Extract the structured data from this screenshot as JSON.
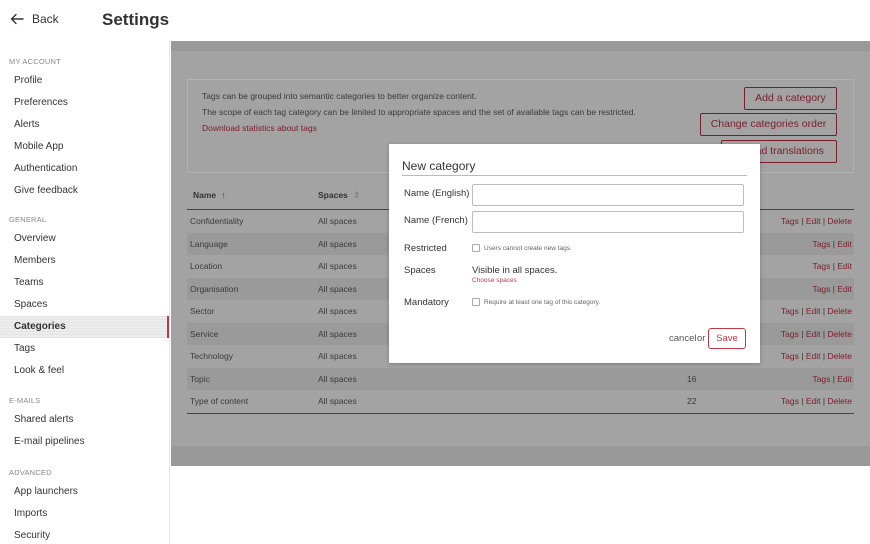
{
  "header": {
    "back_label": "Back",
    "title": "Settings"
  },
  "sidebar": {
    "sections": [
      {
        "title": "MY ACCOUNT",
        "items": [
          "Profile",
          "Preferences",
          "Alerts",
          "Mobile App",
          "Authentication",
          "Give feedback"
        ]
      },
      {
        "title": "GENERAL",
        "items": [
          "Overview",
          "Members",
          "Teams",
          "Spaces",
          "Categories",
          "Tags",
          "Look & feel"
        ]
      },
      {
        "title": "E-MAILS",
        "items": [
          "Shared alerts",
          "E-mail pipelines"
        ]
      },
      {
        "title": "ADVANCED",
        "items": [
          "App launchers",
          "Imports",
          "Security"
        ]
      }
    ],
    "active": "Categories"
  },
  "info": {
    "line1": "Tags can be grouped into semantic categories to better organize content.",
    "line2": "The scope of each tag category can be limited to appropriate spaces and the set of available tags can be restricted.",
    "download_link": "Download statistics about tags",
    "add_button": "Add a category",
    "order_button": "Change categories order",
    "upload_button": "Upload translations"
  },
  "table": {
    "columns": {
      "name": "Name",
      "name_sort": "↑",
      "spaces": "Spaces",
      "spaces_sort": "⇕"
    },
    "rows": [
      {
        "name": "Confidentiality",
        "spaces": "All spaces",
        "count": "",
        "actions": [
          "Tags",
          "Edit",
          "Delete"
        ]
      },
      {
        "name": "Language",
        "spaces": "All spaces",
        "count": "",
        "actions": [
          "Tags",
          "Edit"
        ]
      },
      {
        "name": "Location",
        "spaces": "All spaces",
        "count": "",
        "actions": [
          "Tags",
          "Edit"
        ]
      },
      {
        "name": "Organisation",
        "spaces": "All spaces",
        "count": "",
        "actions": [
          "Tags",
          "Edit"
        ]
      },
      {
        "name": "Sector",
        "spaces": "All spaces",
        "count": "",
        "actions": [
          "Tags",
          "Edit",
          "Delete"
        ]
      },
      {
        "name": "Service",
        "spaces": "All spaces",
        "count": "",
        "actions": [
          "Tags",
          "Edit",
          "Delete"
        ]
      },
      {
        "name": "Technology",
        "spaces": "All spaces",
        "count": "",
        "actions": [
          "Tags",
          "Edit",
          "Delete"
        ]
      },
      {
        "name": "Topic",
        "spaces": "All spaces",
        "count": "16",
        "actions": [
          "Tags",
          "Edit"
        ]
      },
      {
        "name": "Type of content",
        "spaces": "All spaces",
        "count": "22",
        "actions": [
          "Tags",
          "Edit",
          "Delete"
        ]
      }
    ]
  },
  "modal": {
    "title": "New category",
    "name_en_label": "Name (English)",
    "name_en_value": "",
    "name_fr_label": "Name (French)",
    "name_fr_value": "",
    "restricted_label": "Restricted",
    "restricted_text": "Users cannot create new tags.",
    "spaces_label": "Spaces",
    "spaces_value": "Visible in all spaces.",
    "choose_spaces": "Choose spaces",
    "mandatory_label": "Mandatory",
    "mandatory_text": "Require at least one tag of this category.",
    "cancel": "cancel",
    "or": "or",
    "save": "Save"
  },
  "colors": {
    "accent": "#c0394b",
    "overlay": "#999999",
    "link_dim": "#7a1d2b"
  }
}
